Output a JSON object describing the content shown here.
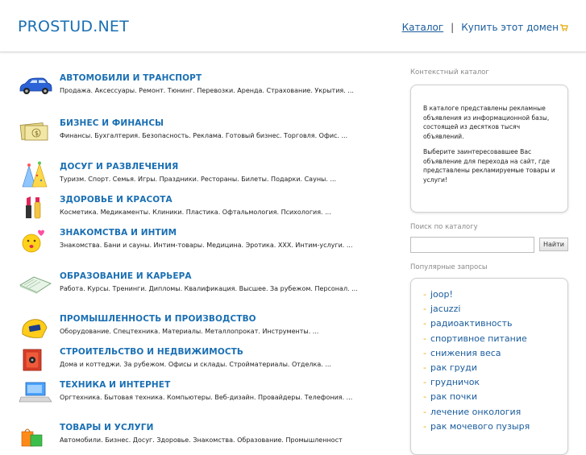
{
  "header": {
    "logo": "PROSTUD.NET",
    "catalog_link": "Каталог",
    "separator": "|",
    "buy_link": "Купить этот домен"
  },
  "categories": [
    {
      "title": "АВТОМОБИЛИ И ТРАНСПОРТ",
      "desc": "Продажа. Аксессуары. Ремонт. Тюнинг. Перевозки. Аренда. Страхование. Укрытия. ...",
      "icon": "car-icon"
    },
    {
      "title": "БИЗНЕС И ФИНАНСЫ",
      "desc": "Финансы. Бухгалтерия. Безопасность. Реклама. Готовый бизнес. Торговля. Офис. ...",
      "icon": "money-icon"
    },
    {
      "title": "ДОСУГ И РАЗВЛЕЧЕНИЯ",
      "desc": "Туризм. Спорт. Семья. Игры. Праздники. Рестораны. Билеты. Подарки. Сауны. ...",
      "icon": "party-hats-icon"
    },
    {
      "title": "ЗДОРОВЬЕ И КРАСОТА",
      "desc": "Косметика. Медикаменты. Клиники. Пластика. Офтальмология. Психология. ...",
      "icon": "cosmetics-icon"
    },
    {
      "title": "ЗНАКОМСТВА И ИНТИМ",
      "desc": "Знакомства. Бани и сауны. Интим-товары. Медицина. Эротика. XXX. Интим-услуги. ...",
      "icon": "kiss-smiley-icon"
    },
    {
      "title": "ОБРАЗОВАНИЕ И КАРЬЕРА",
      "desc": "Работа. Курсы. Тренинги. Дипломы. Квалификация. Высшее. За рубежом. Персонал. ...",
      "icon": "diploma-icon"
    },
    {
      "title": "ПРОМЫШЛЕННОСТЬ И ПРОИЗВОДСТВО",
      "desc": "Оборудование. Спецтехника. Материалы. Металлопрокат. Инструменты. ...",
      "icon": "welding-mask-icon"
    },
    {
      "title": "СТРОИТЕЛЬСТВО И НЕДВИЖИМОСТЬ",
      "desc": "Дома и коттеджи. За рубежом. Офисы и склады. Стройматериалы. Отделка. ...",
      "icon": "safe-icon"
    },
    {
      "title": "ТЕХНИКА И ИНТЕРНЕТ",
      "desc": "Оргтехника. Бытовая техника. Компьютеры. Веб-дизайн. Провайдеры. Телефония. ...",
      "icon": "laptop-icon"
    },
    {
      "title": "ТОВАРЫ И УСЛУГИ",
      "desc": "Автомобили. Бизнес. Досуг. Здоровье. Знакомства. Образование. Промышленност",
      "icon": "shopping-bags-icon"
    }
  ],
  "sidebar": {
    "context_heading": "Контекстный каталог",
    "info_p1": "В каталоге представлены рекламные объявления из информационной базы, состоящей из десятков тысяч объявлений.",
    "info_p2": "Выберите заинтересовавшее Вас объявление для перехода на сайт, где представлены рекламируемые товары и услуги!",
    "search_heading": "Поиск по каталогу",
    "search_value": "",
    "search_button": "Найти",
    "popular_heading": "Популярные запросы",
    "queries": [
      "joop!",
      "jacuzzi",
      "радиоактивность",
      "спортивное питание",
      "снижения веса",
      "рак груди",
      "грудничок",
      "рак почки",
      "лечение онкология",
      "рак мочевого пузыря"
    ]
  },
  "colors": {
    "link": "#1a6fb3",
    "dash": "#e6a800",
    "border": "#cfcfcf"
  }
}
